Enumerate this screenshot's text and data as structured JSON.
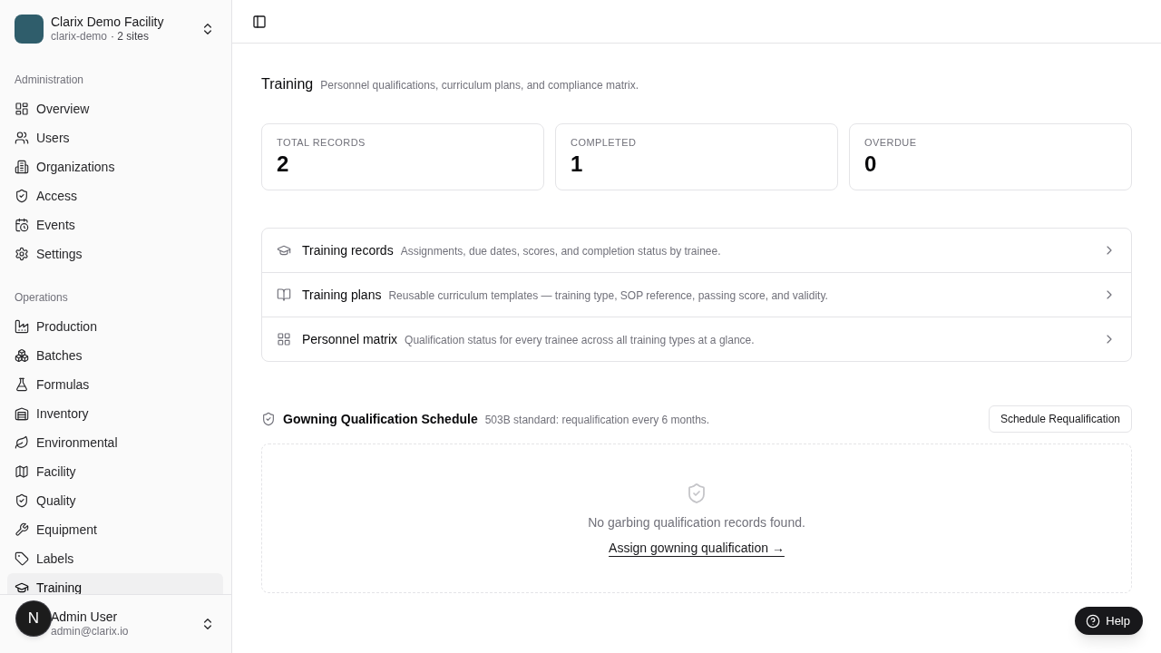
{
  "sidebar": {
    "org": {
      "name": "Clarix Demo Facility",
      "slug": "clarix-demo",
      "sites": "· 2 sites"
    },
    "groups": [
      {
        "label": "Administration",
        "items": [
          {
            "label": "Overview",
            "selected": false
          },
          {
            "label": "Users",
            "selected": false
          },
          {
            "label": "Organizations",
            "selected": false
          },
          {
            "label": "Access",
            "selected": false
          },
          {
            "label": "Events",
            "selected": false
          },
          {
            "label": "Settings",
            "selected": false
          }
        ]
      },
      {
        "label": "Operations",
        "items": [
          {
            "label": "Production",
            "selected": false
          },
          {
            "label": "Batches",
            "selected": false
          },
          {
            "label": "Formulas",
            "selected": false
          },
          {
            "label": "Inventory",
            "selected": false
          },
          {
            "label": "Environmental",
            "selected": false
          },
          {
            "label": "Facility",
            "selected": false
          },
          {
            "label": "Quality",
            "selected": false
          },
          {
            "label": "Equipment",
            "selected": false
          },
          {
            "label": "Labels",
            "selected": false
          },
          {
            "label": "Training",
            "selected": true
          }
        ]
      }
    ],
    "user": {
      "name": "Admin User",
      "email": "admin@clarix.io"
    }
  },
  "dev_badge": {
    "label": "N"
  },
  "page": {
    "title": "Training",
    "description": "Personnel qualifications, curriculum plans, and compliance matrix."
  },
  "stats": [
    {
      "label": "TOTAL RECORDS",
      "value": "2"
    },
    {
      "label": "COMPLETED",
      "value": "1"
    },
    {
      "label": "OVERDUE",
      "value": "0"
    }
  ],
  "links": [
    {
      "title": "Training records",
      "description": "Assignments, due dates, scores, and completion status by trainee."
    },
    {
      "title": "Training plans",
      "description": "Reusable curriculum templates — training type, SOP reference, passing score, and validity."
    },
    {
      "title": "Personnel matrix",
      "description": "Qualification status for every trainee across all training types at a glance."
    }
  ],
  "gowning": {
    "title": "Gowning Qualification Schedule",
    "description": "503B standard: requalification every 6 months.",
    "button": "Schedule Requalification",
    "empty": {
      "message": "No garbing qualification records found.",
      "link": "Assign gowning qualification →"
    }
  },
  "help": {
    "label": "Help"
  }
}
